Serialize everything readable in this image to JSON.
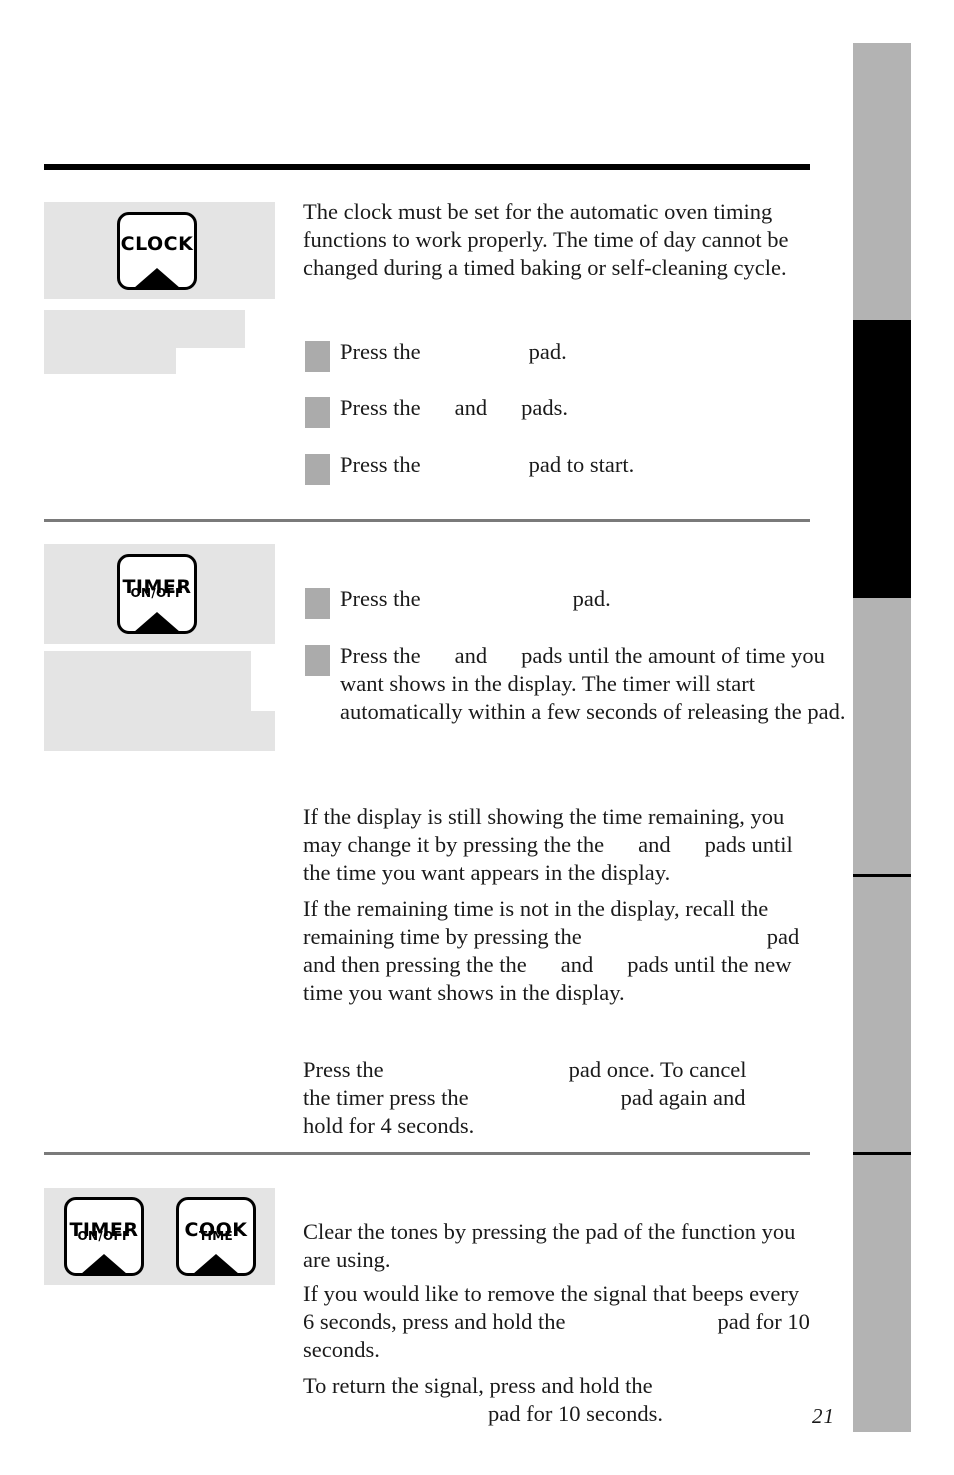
{
  "page": {
    "number": "21"
  },
  "sections": [
    {
      "id": "clock",
      "pads": [
        {
          "line1": "CLOCK",
          "line2": ""
        }
      ],
      "intro": "The clock must be set for the automatic oven timing functions to work properly. The time of day cannot be changed during a timed baking or self-cleaning cycle.",
      "steps": [
        {
          "before": "Press the",
          "after": "pad."
        },
        {
          "before": "Press the",
          "middle": "and",
          "after": "pads."
        },
        {
          "before": "Press the",
          "after": "pad to start."
        }
      ]
    },
    {
      "id": "timer",
      "pads": [
        {
          "line1": "TIMER",
          "line2": "ON/OFF"
        }
      ],
      "steps": [
        {
          "before": "Press the",
          "after": "pad."
        },
        {
          "before": "Press the",
          "middle": "and",
          "after": "pads until the amount of time you want shows in the display. The timer will start automatically within a few seconds of releasing the pad."
        }
      ],
      "paragraphs": [
        {
          "part1": "If the display is still showing the time remaining, you may change it by pressing the the",
          "part2": "and",
          "part3": "pads until the time you want appears in the display."
        },
        {
          "part1": "If the remaining time is not in the display, recall the remaining time by pressing the",
          "part2": "pad and then pressing the the",
          "part3": "and",
          "part4": "pads until the new time you want shows in the display."
        },
        {
          "part1": "Press the",
          "part2": "pad once. To cancel the timer press the",
          "part3": "pad again and hold for 4 seconds."
        }
      ]
    },
    {
      "id": "tones",
      "pads": [
        {
          "line1": "TIMER",
          "line2": "ON/OFF"
        },
        {
          "line1": "COOK",
          "line2": "TIME"
        }
      ],
      "paragraphs": [
        {
          "part1": "Clear the tones by pressing the pad of the function you are using."
        },
        {
          "part1": "If you would like to remove the signal that beeps every 6 seconds, press and hold the",
          "part2": "pad for 10 seconds."
        },
        {
          "part1": "To return the signal, press and hold the",
          "part2": "pad for 10 seconds."
        }
      ]
    }
  ],
  "colors": {
    "rule_dark": "#000000",
    "rule_gray": "#7a7a7a",
    "panel_gray": "#e4e4e4",
    "bullet_gray": "#ababab",
    "tab_gray": "#b3b3b3",
    "tab_black": "#000000"
  }
}
